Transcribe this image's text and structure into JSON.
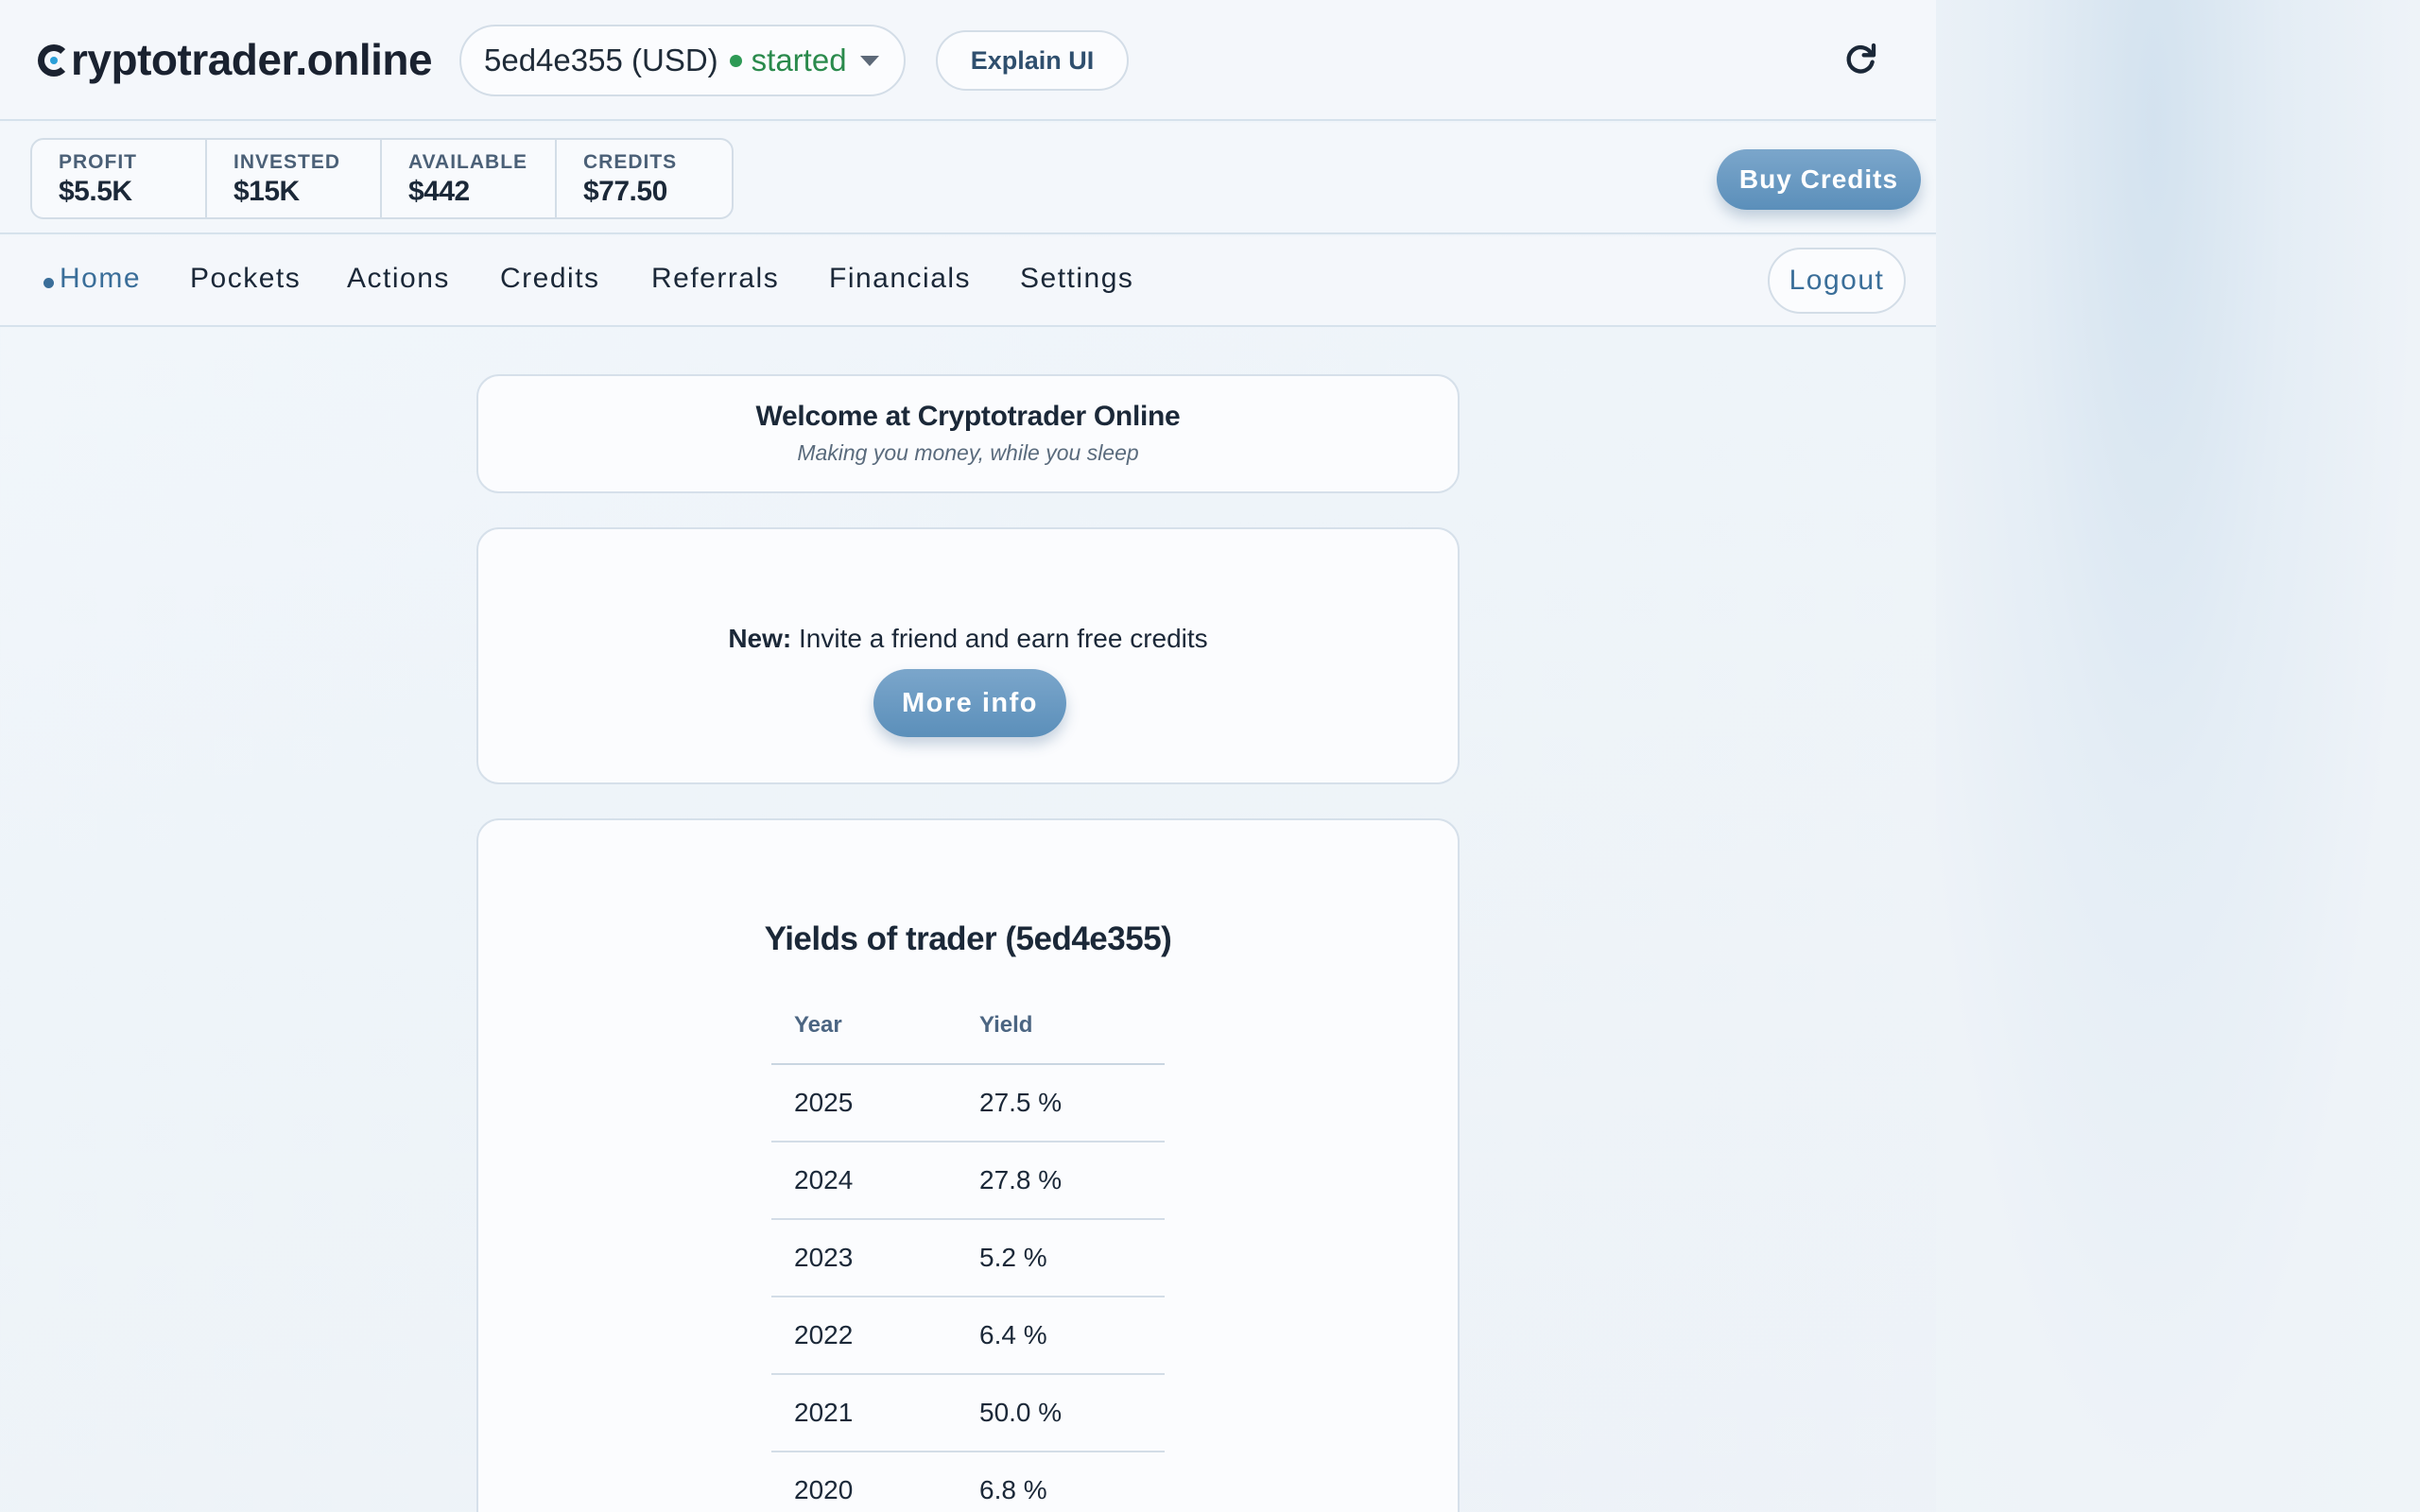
{
  "app": {
    "logo_text": "ryptotrader.online",
    "trader_select": {
      "trader": "5ed4e355 (USD)",
      "status": "started",
      "status_color": "#2e9a55"
    },
    "explain_label": "Explain UI",
    "refresh_icon": "refresh-icon"
  },
  "stats": [
    {
      "label": "PROFIT",
      "value": "$5.5K"
    },
    {
      "label": "INVESTED",
      "value": "$15K"
    },
    {
      "label": "AVAILABLE",
      "value": "$442"
    },
    {
      "label": "CREDITS",
      "value": "$77.50"
    }
  ],
  "buy_credits_label": "Buy Credits",
  "nav": {
    "items": [
      {
        "label": "Home",
        "active": true
      },
      {
        "label": "Pockets"
      },
      {
        "label": "Actions"
      },
      {
        "label": "Credits"
      },
      {
        "label": "Referrals"
      },
      {
        "label": "Financials"
      },
      {
        "label": "Settings"
      }
    ],
    "logout_label": "Logout"
  },
  "welcome": {
    "title": "Welcome at Cryptotrader Online",
    "subtitle": "Making you money, while you sleep"
  },
  "promo": {
    "prefix": "New:",
    "text": " Invite a friend and earn free credits",
    "button_label": "More info"
  },
  "yields": {
    "title": "Yields of trader (5ed4e355)",
    "columns": [
      "Year",
      "Yield"
    ],
    "rows": [
      {
        "year": "2025",
        "yield": "27.5 %"
      },
      {
        "year": "2024",
        "yield": "27.8 %"
      },
      {
        "year": "2023",
        "yield": "5.2 %"
      },
      {
        "year": "2022",
        "yield": "6.4 %"
      },
      {
        "year": "2021",
        "yield": "50.0 %"
      },
      {
        "year": "2020",
        "yield": "6.8 %"
      }
    ]
  },
  "colors": {
    "accent": "#3a6e99",
    "button_gradient_top": "#7ba6cb",
    "button_gradient_bottom": "#5b8fba",
    "logo_dot": "#2a9fd8"
  }
}
